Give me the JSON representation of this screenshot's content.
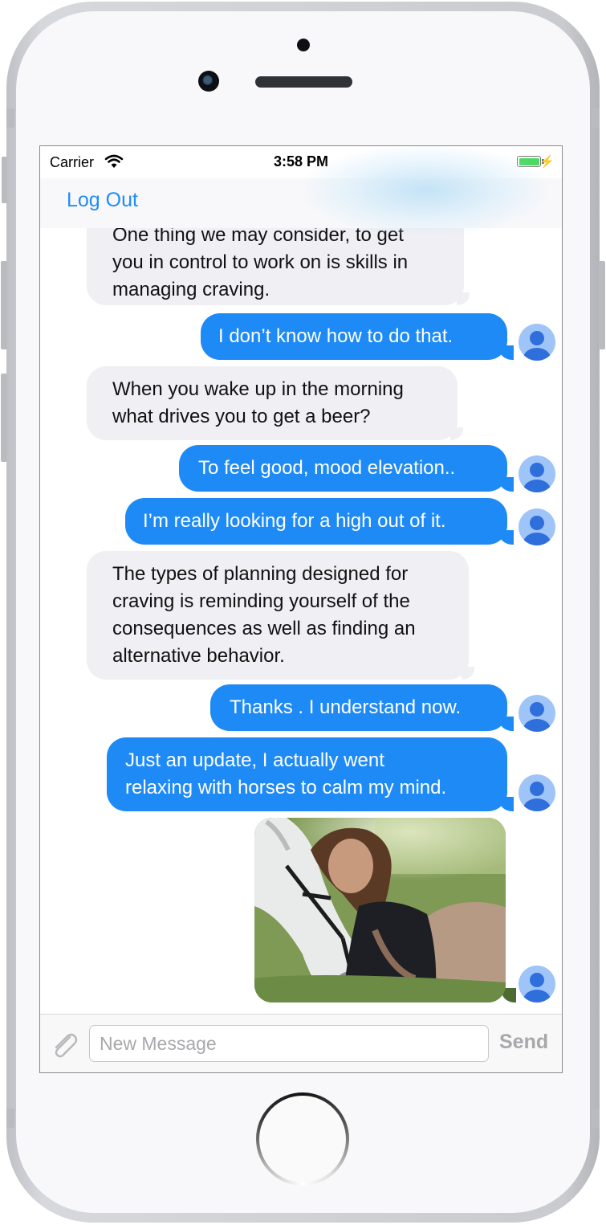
{
  "status_bar": {
    "carrier": "Carrier",
    "time": "3:58 PM"
  },
  "nav": {
    "logout_label": "Log Out"
  },
  "messages": [
    {
      "side": "incoming",
      "lines": [
        "One thing we may consider, to get",
        "you in control to work on is skills in",
        "managing craving."
      ]
    },
    {
      "side": "outgoing",
      "lines": [
        "I don’t know how to do that."
      ]
    },
    {
      "side": "incoming",
      "lines": [
        "When you wake up in the morning",
        "what drives you to get a beer?"
      ]
    },
    {
      "side": "outgoing",
      "lines": [
        "To feel good, mood elevation.."
      ]
    },
    {
      "side": "outgoing",
      "lines": [
        "I’m really looking for a high out of it."
      ]
    },
    {
      "side": "incoming",
      "lines": [
        "The types of planning designed for",
        "craving is reminding yourself of the",
        "consequences as well as finding an",
        "alternative behavior."
      ]
    },
    {
      "side": "outgoing",
      "lines": [
        "Thanks . I understand now."
      ]
    },
    {
      "side": "outgoing",
      "lines": [
        "Just an update, I actually went",
        "relaxing with horses to calm my mind."
      ]
    },
    {
      "side": "outgoing",
      "type": "image",
      "image_subject": "woman-with-white-horse"
    }
  ],
  "composer": {
    "placeholder": "New Message",
    "value": "",
    "send_label": "Send",
    "attach_icon": "paperclip-icon"
  },
  "colors": {
    "accent": "#1f8cf7",
    "outgoing_bubble": "#1e8af6",
    "incoming_bubble": "#efeff4",
    "avatar_bg": "#9fc4f8"
  }
}
